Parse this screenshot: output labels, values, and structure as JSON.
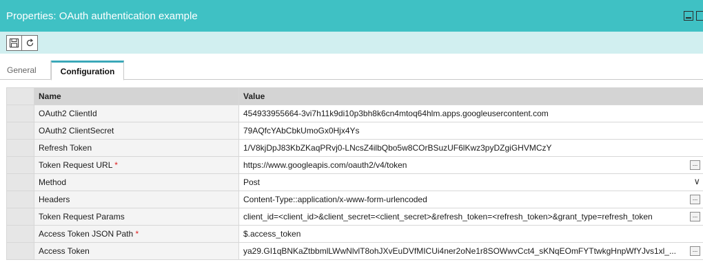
{
  "window": {
    "title": "Properties: OAuth authentication example"
  },
  "toolbar": {
    "save_icon": "save-icon",
    "refresh_icon": "refresh-icon"
  },
  "tabs": [
    {
      "label": "General"
    },
    {
      "label": "Configuration"
    }
  ],
  "grid": {
    "columns": {
      "name": "Name",
      "value": "Value"
    },
    "rows": [
      {
        "name": "OAuth2 ClientId",
        "required": "",
        "value": "454933955664-3vi7h11k9di10p3bh8k6cn4mtoq64hlm.apps.googleusercontent.com"
      },
      {
        "name": "OAuth2 ClientSecret",
        "required": "",
        "value": "79AQfcYAbCbkUmoGx0Hjx4Ys"
      },
      {
        "name": "Refresh Token",
        "required": "",
        "value": "1/V8kjDpJ83KbZKaqPRvj0-LNcsZ4ilbQbo5w8COrBSuzUF6lKwz3pyDZgiGHVMCzY"
      },
      {
        "name": "Token Request URL",
        "required": "*",
        "value": "https://www.googleapis.com/oauth2/v4/token"
      },
      {
        "name": "Method",
        "required": "",
        "value": "Post"
      },
      {
        "name": "Headers",
        "required": "",
        "value": "Content-Type::application/x-www-form-urlencoded"
      },
      {
        "name": "Token Request Params",
        "required": "",
        "value": "client_id=<client_id>&client_secret=<client_secret>&refresh_token=<refresh_token>&grant_type=refresh_token"
      },
      {
        "name": "Access Token JSON Path",
        "required": "*",
        "value": "$.access_token"
      },
      {
        "name": "Access Token",
        "required": "",
        "value": "ya29.GI1qBNKaZtbbmlLWwNlvlT8ohJXvEuDVfMICUi4ner2oNe1r8SOWwvCct4_sKNqEOmFYTtwkgHnpWfYJvs1xl_..."
      }
    ],
    "ellipsis_label": "...",
    "dropdown_glyph": "∨"
  }
}
